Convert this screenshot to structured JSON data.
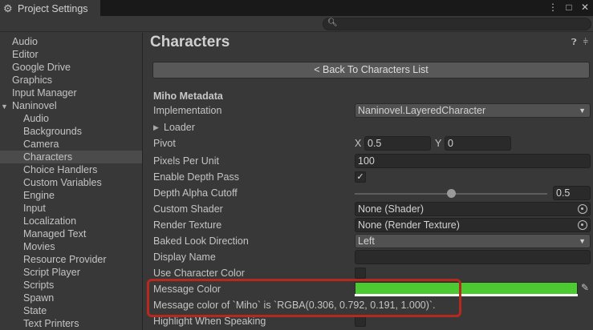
{
  "window": {
    "tab_title": "Project Settings",
    "controls": [
      "⋮",
      "□",
      "✕"
    ]
  },
  "search": {
    "placeholder": "",
    "value": ""
  },
  "sidebar": {
    "items": [
      {
        "label": "Audio",
        "level": 0
      },
      {
        "label": "Editor",
        "level": 0
      },
      {
        "label": "Google Drive",
        "level": 0
      },
      {
        "label": "Graphics",
        "level": 0
      },
      {
        "label": "Input Manager",
        "level": 0
      },
      {
        "label": "Naninovel",
        "level": 0,
        "expanded": true
      },
      {
        "label": "Audio",
        "level": 1
      },
      {
        "label": "Backgrounds",
        "level": 1
      },
      {
        "label": "Camera",
        "level": 1
      },
      {
        "label": "Characters",
        "level": 1,
        "selected": true
      },
      {
        "label": "Choice Handlers",
        "level": 1
      },
      {
        "label": "Custom Variables",
        "level": 1
      },
      {
        "label": "Engine",
        "level": 1
      },
      {
        "label": "Input",
        "level": 1
      },
      {
        "label": "Localization",
        "level": 1
      },
      {
        "label": "Managed Text",
        "level": 1
      },
      {
        "label": "Movies",
        "level": 1
      },
      {
        "label": "Resource Provider",
        "level": 1
      },
      {
        "label": "Script Player",
        "level": 1
      },
      {
        "label": "Scripts",
        "level": 1
      },
      {
        "label": "Spawn",
        "level": 1
      },
      {
        "label": "State",
        "level": 1
      },
      {
        "label": "Text Printers",
        "level": 1
      }
    ]
  },
  "main": {
    "title": "Characters",
    "back_button": "< Back To Characters List",
    "section_header": "Miho Metadata",
    "implementation": {
      "label": "Implementation",
      "value": "Naninovel.LayeredCharacter"
    },
    "loader": {
      "label": "Loader"
    },
    "pivot": {
      "label": "Pivot",
      "x_label": "X",
      "x": "0.5",
      "y_label": "Y",
      "y": "0"
    },
    "pixels_per_unit": {
      "label": "Pixels Per Unit",
      "value": "100"
    },
    "enable_depth_pass": {
      "label": "Enable Depth Pass",
      "checked": true,
      "mark": "✓"
    },
    "depth_alpha_cutoff": {
      "label": "Depth Alpha Cutoff",
      "value": "0.5",
      "fraction": 0.5
    },
    "custom_shader": {
      "label": "Custom Shader",
      "value": "None (Shader)"
    },
    "render_texture": {
      "label": "Render Texture",
      "value": "None (Render Texture)"
    },
    "baked_look_direction": {
      "label": "Baked Look Direction",
      "value": "Left"
    },
    "display_name": {
      "label": "Display Name",
      "value": ""
    },
    "use_character_color": {
      "label": "Use Character Color",
      "checked": false
    },
    "message_color": {
      "label": "Message Color",
      "color": "#4dca31"
    },
    "message_color_info": "Message color of `Miho` is `RGBA(0.306, 0.792, 0.191, 1.000)`.",
    "highlight_when_speaking": {
      "label": "Highlight When Speaking",
      "checked": false
    }
  },
  "colors": {
    "background": "#383838",
    "field": "#2a2a2a",
    "selection": "#4b4b4b",
    "highlight_annotation": "#b5291f"
  }
}
